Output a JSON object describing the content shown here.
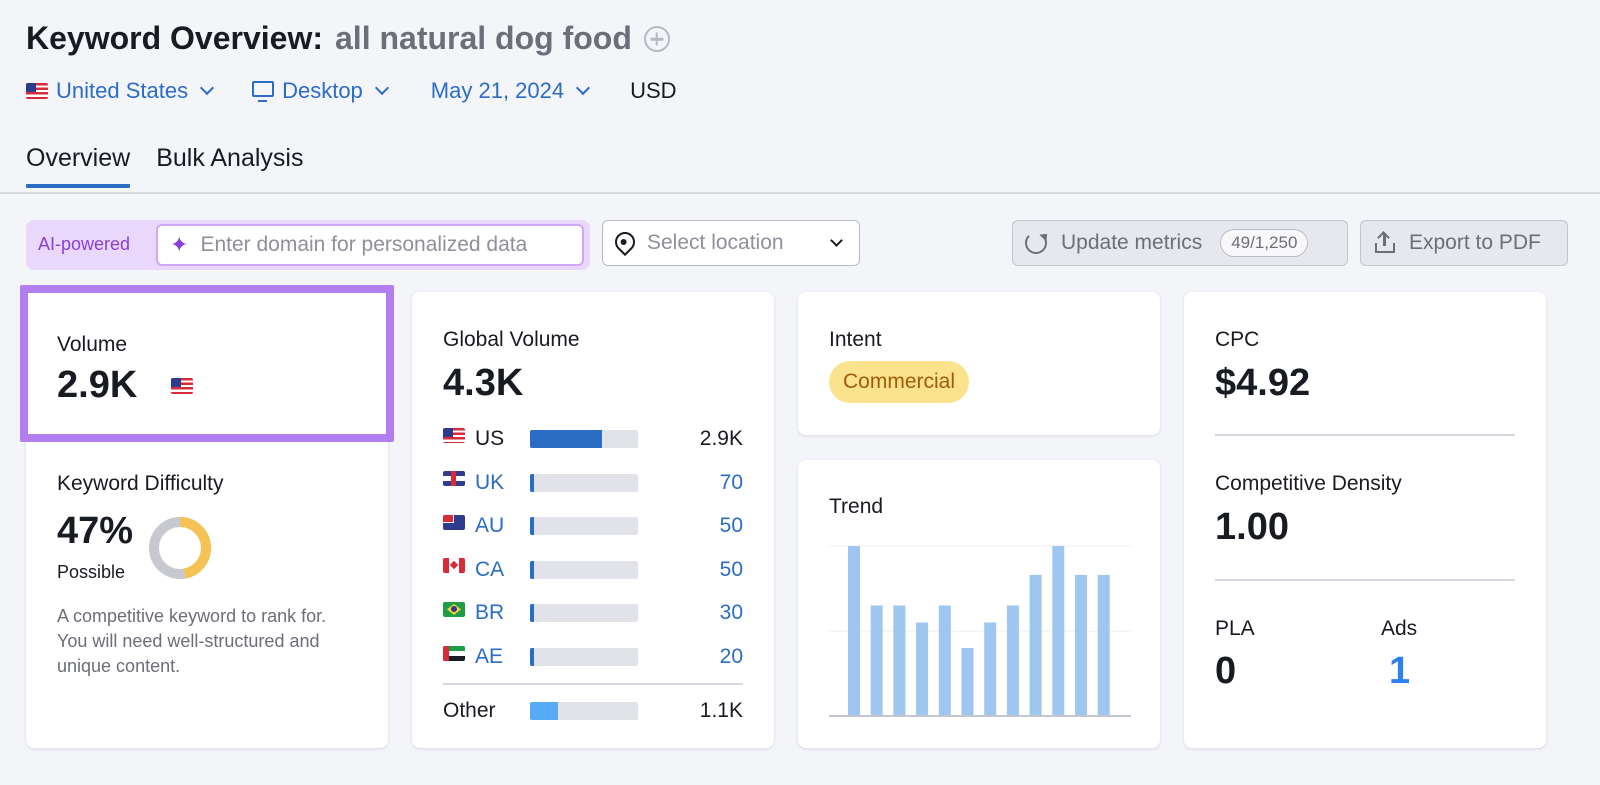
{
  "header": {
    "title_label": "Keyword Overview:",
    "keyword": "all natural dog food"
  },
  "filters": {
    "country": "United States",
    "device": "Desktop",
    "date": "May 21, 2024",
    "currency": "USD"
  },
  "tabs": [
    {
      "label": "Overview",
      "active": true
    },
    {
      "label": "Bulk Analysis",
      "active": false
    }
  ],
  "toolbar": {
    "ai_label": "AI-powered",
    "domain_placeholder": "Enter domain for personalized data",
    "location_placeholder": "Select location",
    "update_label": "Update metrics",
    "update_counter": "49/1,250",
    "export_label": "Export to PDF"
  },
  "volume": {
    "label": "Volume",
    "value": "2.9K"
  },
  "keyword_difficulty": {
    "label": "Keyword Difficulty",
    "value": "47%",
    "percent": 47,
    "rating": "Possible",
    "description": "A competitive keyword to rank for. You will need well-structured and unique content."
  },
  "global_volume": {
    "label": "Global Volume",
    "value": "4.3K",
    "countries": [
      {
        "code": "US",
        "value": "2.9K",
        "share": 0.67,
        "link": false,
        "flag": "us"
      },
      {
        "code": "UK",
        "value": "70",
        "share": 0.03,
        "link": true,
        "flag": "uk"
      },
      {
        "code": "AU",
        "value": "50",
        "share": 0.03,
        "link": true,
        "flag": "au"
      },
      {
        "code": "CA",
        "value": "50",
        "share": 0.03,
        "link": true,
        "flag": "ca"
      },
      {
        "code": "BR",
        "value": "30",
        "share": 0.03,
        "link": true,
        "flag": "br"
      },
      {
        "code": "AE",
        "value": "20",
        "share": 0.03,
        "link": true,
        "flag": "ae"
      }
    ],
    "other": {
      "label": "Other",
      "value": "1.1K",
      "share": 0.26
    }
  },
  "intent": {
    "label": "Intent",
    "badge": "Commercial"
  },
  "trend": {
    "label": "Trend",
    "values": [
      100,
      65,
      65,
      55,
      65,
      40,
      55,
      65,
      83,
      100,
      83,
      83
    ]
  },
  "cpc": {
    "label": "CPC",
    "value": "$4.92"
  },
  "competitive_density": {
    "label": "Competitive Density",
    "value": "1.00"
  },
  "pla": {
    "label": "PLA",
    "value": "0"
  },
  "ads": {
    "label": "Ads",
    "value": "1"
  },
  "colors": {
    "accent_blue": "#2b6cc4",
    "highlight_purple": "#b37ef0",
    "trend_bar": "#9ec6ee",
    "kd_fill": "#f5c355",
    "kd_track": "#c8c9d0",
    "badge_bg": "#fbe38e"
  }
}
